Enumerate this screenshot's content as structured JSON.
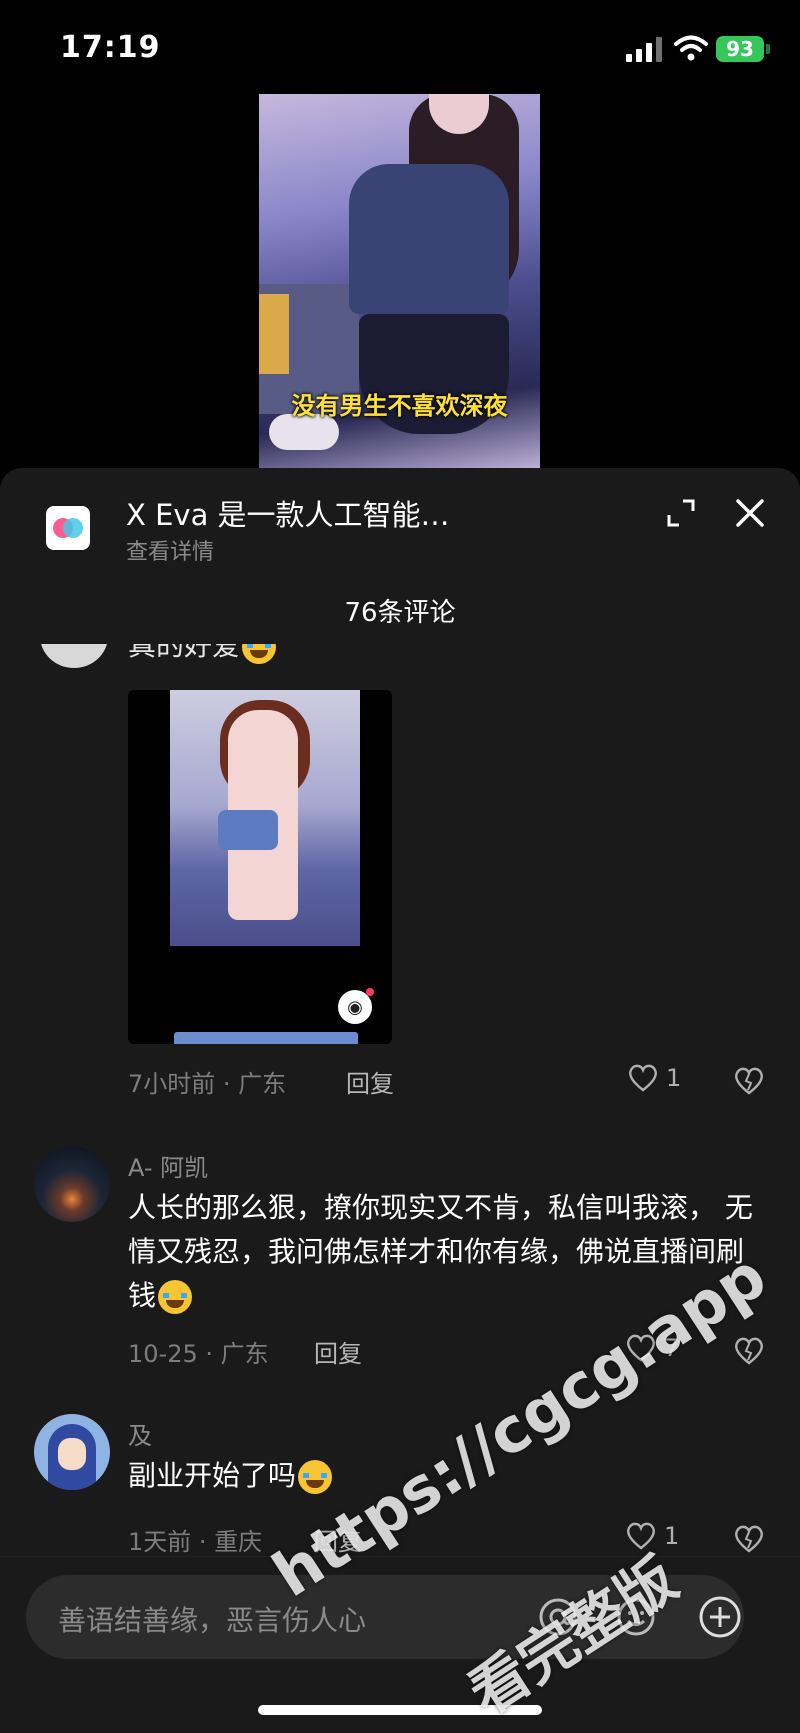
{
  "status_bar": {
    "time": "17:19",
    "battery": "93"
  },
  "video": {
    "caption": "没有男生不喜欢深夜"
  },
  "ad": {
    "title": "X Eva 是一款人工智能…",
    "subtitle": "查看详情"
  },
  "comments_header": {
    "count_label": "76条评论"
  },
  "comments": [
    {
      "partial_text": "真的好爱",
      "meta": "7小时前 · 广东",
      "reply": "回复",
      "likes": "1"
    },
    {
      "user": "A- 阿凯",
      "text": "人长的那么狠，撩你现实又不肯，私信叫我滚， 无情又残忍，我问佛怎样才和你有缘，佛说直播间刷钱",
      "meta": "10-25 · 广东",
      "reply": "回复",
      "likes": "7"
    },
    {
      "user": "及",
      "text": "副业开始了吗",
      "meta": "1天前 · 重庆",
      "reply": "回复",
      "likes": "1"
    }
  ],
  "input": {
    "placeholder": "善语结善缘，恶言伤人心"
  },
  "watermark": {
    "line1": "https://cgcg.app",
    "line2": "看完整版"
  },
  "colors": {
    "sheet_bg": "#1a1a1a",
    "battery_green": "#35c759",
    "caption_yellow": "#ffe135"
  }
}
